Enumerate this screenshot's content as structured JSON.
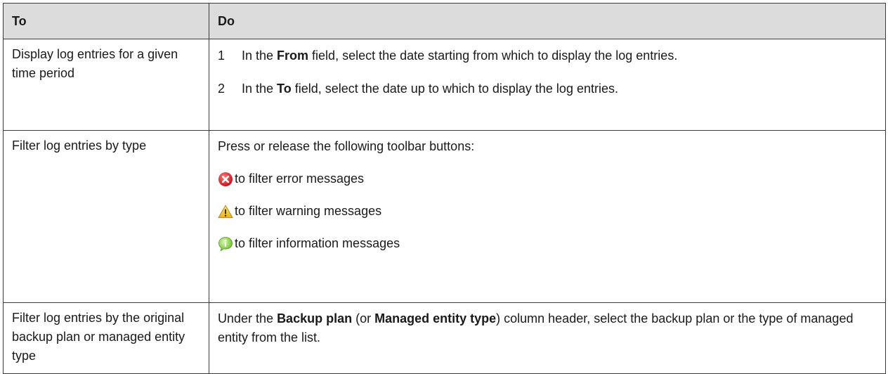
{
  "table": {
    "headers": {
      "to": "To",
      "do": "Do"
    },
    "rows": [
      {
        "to": "Display log entries for a given time period",
        "steps": [
          {
            "num": "1",
            "pre": "In the ",
            "bold": "From",
            "post": " field, select the date starting from which to display the log entries."
          },
          {
            "num": "2",
            "pre": "In the ",
            "bold": "To",
            "post": " field, select the date up to which to display the log entries."
          }
        ]
      },
      {
        "to": "Filter log entries by type",
        "intro": "Press or release the following toolbar buttons:",
        "buttons": [
          {
            "icon": "error-icon",
            "text": "to filter error messages",
            "color": "#e0303a"
          },
          {
            "icon": "warning-icon",
            "text": "to filter warning messages",
            "color": "#f2c230"
          },
          {
            "icon": "information-icon",
            "text": "to filter information messages",
            "color": "#8fd14f"
          }
        ]
      },
      {
        "to": "Filter log entries by the original backup plan or managed entity type",
        "do": {
          "pre": "Under the ",
          "bold1": "Backup plan",
          "mid1": " (or ",
          "bold2": "Managed entity type",
          "post": ") column header, select the backup plan or the type of managed entity from the list."
        }
      }
    ]
  }
}
